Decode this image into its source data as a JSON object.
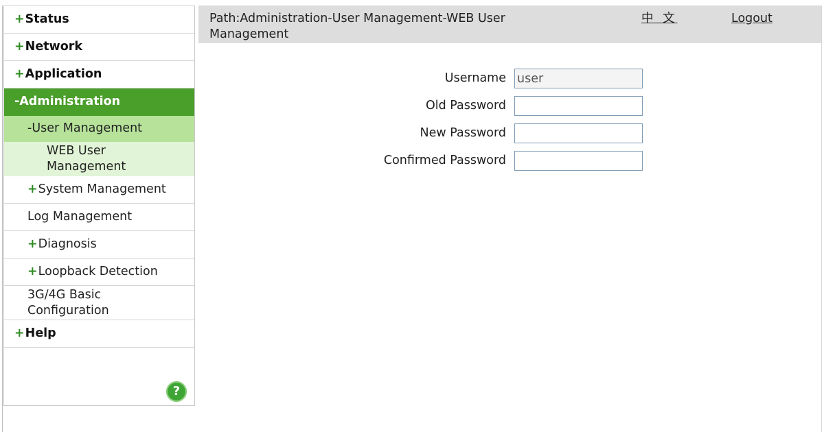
{
  "sidebar": {
    "items": [
      {
        "label": "Status",
        "plus": "+",
        "level": 1,
        "state": "collapsed"
      },
      {
        "label": "Network",
        "plus": "+",
        "level": 1,
        "state": "collapsed"
      },
      {
        "label": "Application",
        "plus": "+",
        "level": 1,
        "state": "collapsed"
      },
      {
        "label": "-Administration",
        "plus": "",
        "level": 1,
        "state": "expanded-active"
      },
      {
        "label": "-User Management",
        "plus": "",
        "level": 2,
        "state": "expanded-active"
      },
      {
        "label": "WEB User Management",
        "plus": "",
        "level": 3,
        "state": "selected"
      },
      {
        "label": "System Management",
        "plus": "+",
        "level": 2,
        "state": "collapsed"
      },
      {
        "label": "Log Management",
        "plus": "",
        "level": 2,
        "state": "leaf"
      },
      {
        "label": "Diagnosis",
        "plus": "+",
        "level": 2,
        "state": "collapsed"
      },
      {
        "label": "Loopback Detection",
        "plus": "+",
        "level": 2,
        "state": "collapsed"
      },
      {
        "label": "3G/4G Basic Configuration",
        "plus": "",
        "level": 2,
        "state": "leaf"
      },
      {
        "label": "Help",
        "plus": "+",
        "level": 1,
        "state": "collapsed"
      }
    ],
    "help_button_glyph": "?",
    "help_icon": "help-circle-icon"
  },
  "header": {
    "path": "Path:Administration-User Management-WEB User Management",
    "language_link": "中 文",
    "logout_link": "Logout"
  },
  "form": {
    "username_label": "Username",
    "username_value": "user",
    "old_password_label": "Old Password",
    "new_password_label": "New Password",
    "confirmed_password_label": "Confirmed Password"
  },
  "colors": {
    "active_menu_bg": "#4a9e2a",
    "active_submenu_bg": "#b6e29a",
    "selected_leaf_bg": "#e1f4d7",
    "plus_green": "#2e8b22",
    "header_bg": "#dddddd"
  }
}
